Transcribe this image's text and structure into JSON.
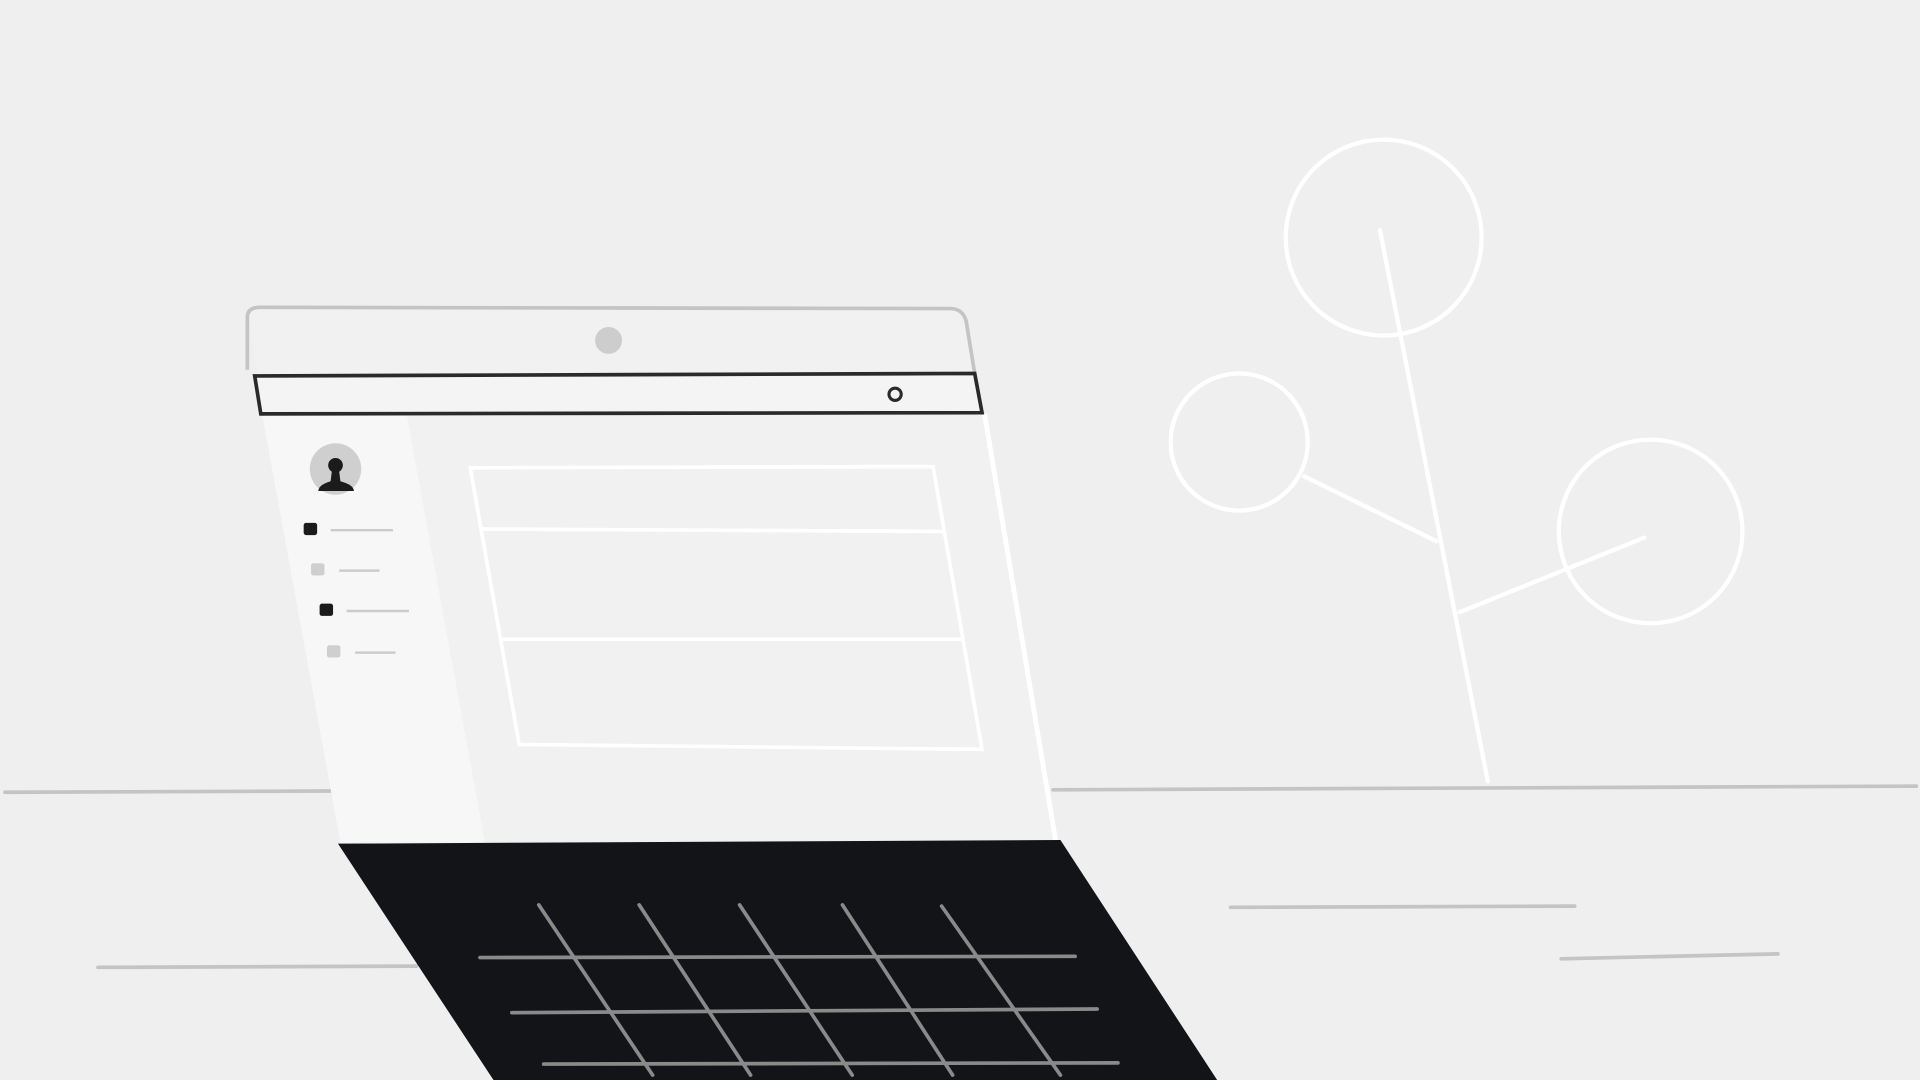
{
  "colors": {
    "background": "#efefef",
    "screen": "#f4f4f4",
    "sidebar": "#f7f7f7",
    "outline_dark": "#2a2a2a",
    "outline_light": "#c4c4c4",
    "keyboard": "#131418",
    "keys": "#8a8a8a",
    "plant": "#ffffff",
    "avatar_bg": "#cfcfcf",
    "avatar_fg": "#1b1b1b"
  },
  "icons": {
    "camera": "camera-dot-icon",
    "search": "search-circle-icon",
    "avatar": "user-avatar-icon",
    "bullet": "list-bullet-icon"
  }
}
